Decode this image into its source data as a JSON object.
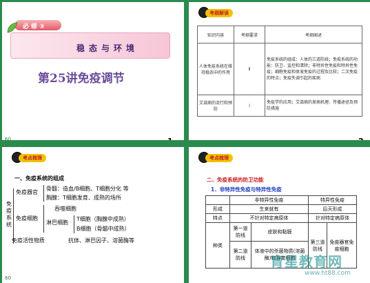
{
  "slide1": {
    "tag": "必修③",
    "band_title": "稳态与环境",
    "lecture": "第25讲免疫调节",
    "page_number_left": "60",
    "page_number": "1"
  },
  "slide2": {
    "badge": "考纲解读",
    "headers": [
      "知识内容",
      "考纲要求",
      "考纲阐述"
    ],
    "rows": [
      {
        "c1": "人体免疫系统在维持稳态中的作用",
        "c2": "Ⅱ",
        "c3": "免疫系统的组成：人体的三道防线；免疫系统的功能：防卫、监控和清除；非特异性免疫和特异性免疫；细胞免疫和体液免疫的过程及比较；二次免疫的特点；免疫失调引起的疾病"
      },
      {
        "c1": "艾滋病的流行和预防",
        "c2": "Ⅰ",
        "c3": "免疫学的应用；艾滋病的发病机理、传播途径及预防措施"
      }
    ],
    "page_number": "2"
  },
  "slide3": {
    "badge": "考点梳理",
    "heading": "一、免疫系统的组成",
    "left_label": "免疫系统",
    "organ_label": "免疫器官",
    "organ_l1": "骨髓：造血/B细胞、T细胞分化 等",
    "organ_l2": "胸腺：T细胞发育、成熟的场所",
    "cell_label": "免疫细胞",
    "cell_l1": "吞噬细胞",
    "cell_l2": "淋巴细胞",
    "cell_l3": "T细胞（胸腺中成熟）",
    "cell_l4": "B细胞（骨髓中成熟）",
    "active_label": "免疫活性物质",
    "active_l1": "抗体、淋巴因子、溶菌酶等",
    "page_number_left": "60"
  },
  "slide4": {
    "badge": "考点梳理",
    "heading2": "二、免疫系统的防卫功能",
    "heading3": "1．非特异性免疫与特异性免疫",
    "col_headers": [
      "",
      "非特异性免疫",
      "特异性免疫"
    ],
    "row_form": [
      "形成",
      "生来就有",
      "后天形成"
    ],
    "row_trait": [
      "特点",
      "不针对特定病原体",
      "针对特定病原体"
    ],
    "type_label": "种类",
    "first_line": "第一道防线",
    "first_content": "皮肤和黏膜",
    "second_line": "第二道防线",
    "second_content": "体液中的杀菌物质(溶菌酶)和吞噬细胞",
    "third_line": "第三道防线",
    "third_content": "免疫器官免疫细胞",
    "watermark": "育星教育网",
    "watermark_url": "www.ht88.com"
  }
}
